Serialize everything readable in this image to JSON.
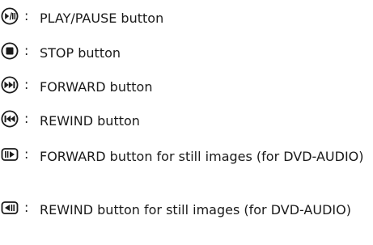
{
  "legend": {
    "items": [
      {
        "icon": "play-pause-icon",
        "separator": ":",
        "text": "PLAY/PAUSE button"
      },
      {
        "icon": "stop-icon",
        "separator": ":",
        "text": "STOP button"
      },
      {
        "icon": "forward-icon",
        "separator": ":",
        "text": "FORWARD button"
      },
      {
        "icon": "rewind-icon",
        "separator": ":",
        "text": "REWIND button"
      },
      {
        "icon": "still-forward-icon",
        "separator": ":",
        "text": "FORWARD button for still images (for DVD-AUDIO)"
      },
      {
        "icon": "still-rewind-icon",
        "separator": ":",
        "text": "REWIND button for still images (for DVD-AUDIO)"
      }
    ]
  }
}
